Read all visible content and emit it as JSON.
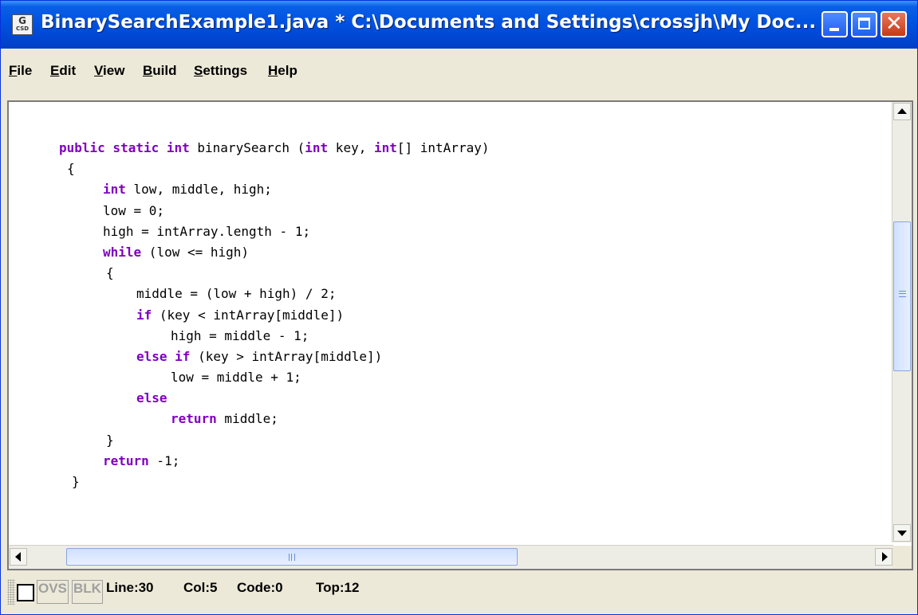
{
  "window": {
    "title": "BinarySearchExample1.java *  C:\\Documents and Settings\\crossjh\\My Doc...",
    "icon_text_top": "G",
    "icon_text_bottom": "CSD",
    "close_glyph": "✕"
  },
  "menu": {
    "items": [
      {
        "mnemonic": "F",
        "rest": "ile"
      },
      {
        "mnemonic": "E",
        "rest": "dit"
      },
      {
        "mnemonic": "V",
        "rest": "iew"
      },
      {
        "mnemonic": "B",
        "rest": "uild"
      },
      {
        "mnemonic": "S",
        "rest": "ettings"
      },
      {
        "mnemonic": "H",
        "rest": "elp"
      }
    ]
  },
  "code": {
    "l1": {
      "kw1": "public static int",
      "t1": " binarySearch (",
      "kw2": "int",
      "t2": " key, ",
      "kw3": "int",
      "t3": "[] intArray)"
    },
    "l2": "{",
    "l3": {
      "kw": "int",
      "t": " low, middle, high;"
    },
    "l4": "low = 0;",
    "l5": "high = intArray.length - 1;",
    "l6": {
      "kw": "while",
      "t": " (low <= high)"
    },
    "l7": "{",
    "l8": "middle = (low + high) / 2;",
    "l9": {
      "kw": "if",
      "t": " (key < intArray[middle])"
    },
    "l10": "high = middle - 1;",
    "l11": {
      "kw": "else if",
      "t": " (key > intArray[middle])"
    },
    "l12": "low = middle + 1;",
    "l13": {
      "kw": "else",
      "t": ""
    },
    "l14": {
      "kw": "return",
      "t": " middle;"
    },
    "l15": "}",
    "l16": {
      "kw": "return",
      "t": " -1;"
    },
    "l17": "}"
  },
  "status": {
    "ovs": "OVS",
    "blk": "BLK",
    "line": "Line:30",
    "col": "Col:5",
    "code": "Code:0",
    "top": "Top:12"
  },
  "colors": {
    "keyword": "#8000c0",
    "titlebar": "#0054e3",
    "chrome": "#ece9d8"
  },
  "icons": [
    "app-icon",
    "minimize-icon",
    "maximize-icon",
    "close-icon",
    "scroll-up-icon",
    "scroll-down-icon",
    "scroll-left-icon",
    "scroll-right-icon"
  ]
}
